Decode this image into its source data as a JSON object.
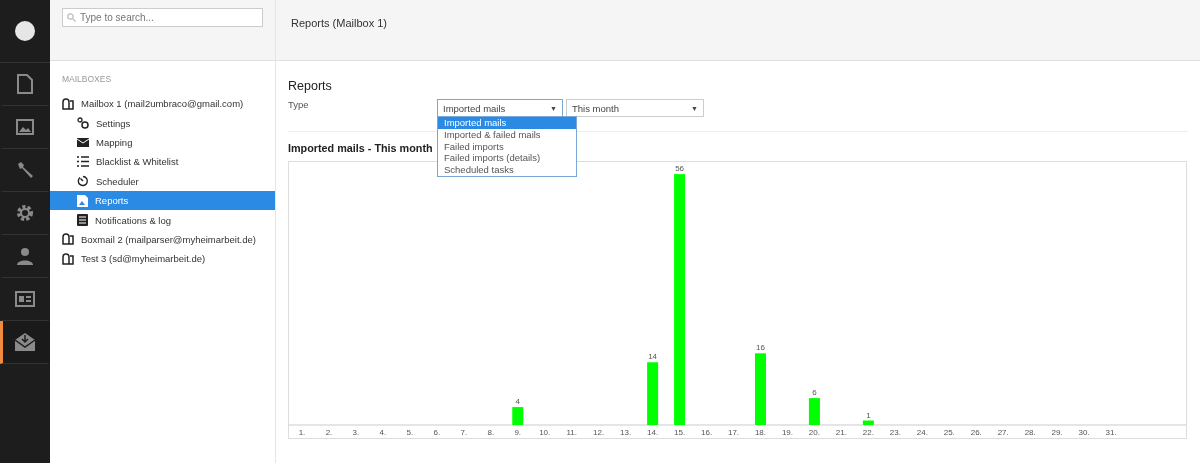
{
  "nav": [
    {
      "kind": "document",
      "selected": false
    },
    {
      "kind": "image",
      "selected": false
    },
    {
      "kind": "wrench",
      "selected": false
    },
    {
      "kind": "gear",
      "selected": false
    },
    {
      "kind": "user",
      "selected": false
    },
    {
      "kind": "card",
      "selected": false
    },
    {
      "kind": "mail",
      "selected": true
    }
  ],
  "search": {
    "placeholder": "Type to search..."
  },
  "sidebar": {
    "heading": "MAILBOXES",
    "items": [
      {
        "label": "Mailbox 1 (mail2umbraco@gmail.com)",
        "kind": "mailbox",
        "selected": false,
        "children": [
          {
            "label": "Settings",
            "kind": "settings",
            "selected": false
          },
          {
            "label": "Mapping",
            "kind": "mapping",
            "selected": false
          },
          {
            "label": "Blacklist & Whitelist",
            "kind": "list",
            "selected": false
          },
          {
            "label": "Scheduler",
            "kind": "clock",
            "selected": false
          },
          {
            "label": "Reports",
            "kind": "report",
            "selected": true
          },
          {
            "label": "Notifications & log",
            "kind": "log",
            "selected": false
          }
        ]
      },
      {
        "label": "Boxmail 2 (mailparser@myheimarbeit.de)",
        "kind": "mailbox",
        "selected": false
      },
      {
        "label": "Test 3 (sd@myheimarbeit.de)",
        "kind": "mailbox",
        "selected": false
      }
    ]
  },
  "header": {
    "title": "Reports (Mailbox 1)"
  },
  "reports": {
    "title": "Reports",
    "type_label": "Type",
    "type_select": {
      "value": "Imported mails",
      "caret": "▼",
      "expanded": true,
      "options": [
        {
          "label": "Imported mails",
          "selected": true
        },
        {
          "label": "Imported & failed mails",
          "selected": false
        },
        {
          "label": "Failed imports",
          "selected": false
        },
        {
          "label": "Failed imports (details)",
          "selected": false
        },
        {
          "label": "Scheduled tasks",
          "selected": false
        }
      ]
    },
    "period_select": {
      "value": "This month",
      "caret": "▼"
    },
    "chart_title": "Imported mails - This month",
    "chart_data": {
      "type": "bar",
      "categories": [
        "1.",
        "2.",
        "3.",
        "4.",
        "5.",
        "6.",
        "7.",
        "8.",
        "9.",
        "10.",
        "11.",
        "12.",
        "13.",
        "14.",
        "15.",
        "16.",
        "17.",
        "18.",
        "19.",
        "20.",
        "21.",
        "22.",
        "23.",
        "24.",
        "25.",
        "26.",
        "27.",
        "28.",
        "29.",
        "30.",
        "31."
      ],
      "series": [
        {
          "color": "#00ff00",
          "values": [
            null,
            null,
            null,
            null,
            null,
            null,
            null,
            null,
            4,
            null,
            null,
            null,
            null,
            14,
            56,
            null,
            null,
            16,
            null,
            6,
            null,
            1,
            null,
            null,
            null,
            null,
            null,
            null,
            null,
            null,
            null
          ]
        }
      ],
      "data_labels": true
    }
  }
}
